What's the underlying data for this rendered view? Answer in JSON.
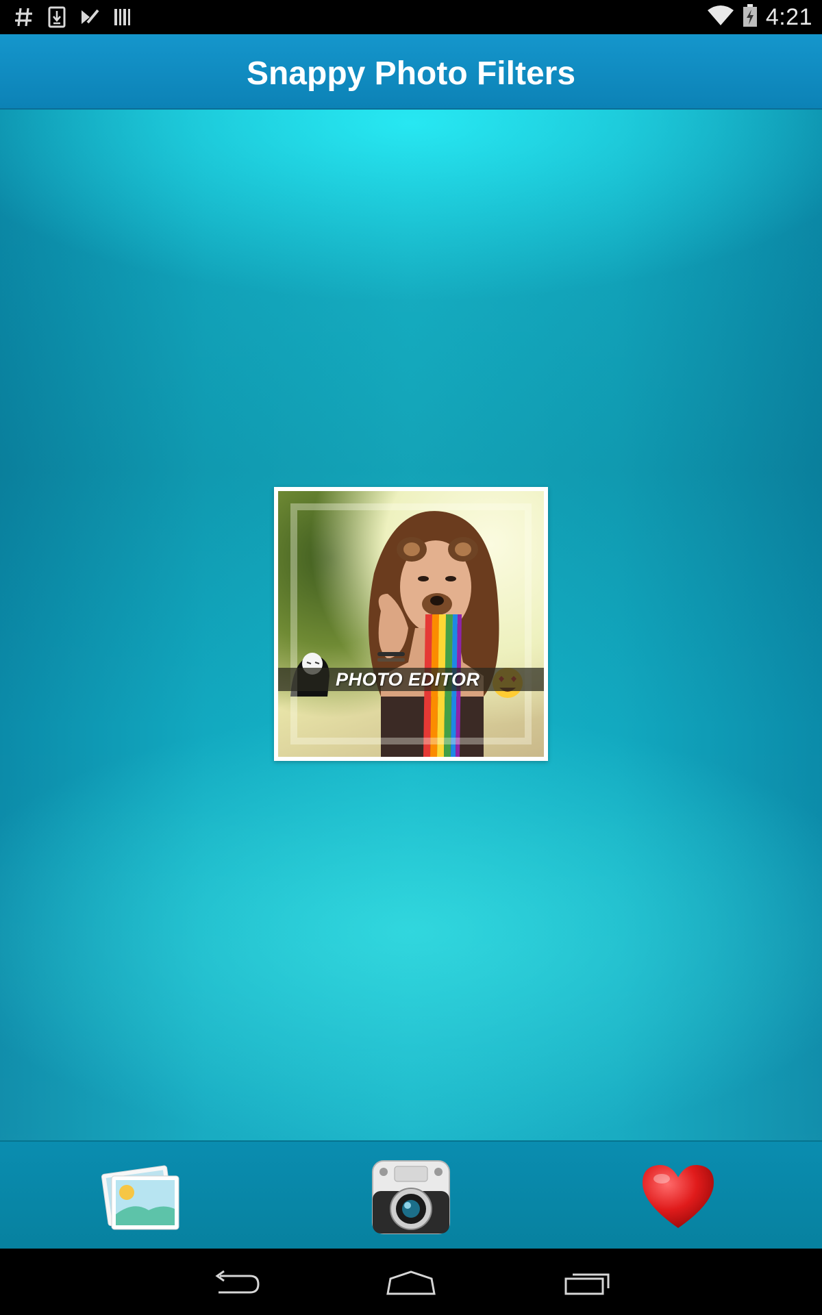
{
  "status_bar": {
    "icons": [
      "hash-icon",
      "download-icon",
      "play-store-icon",
      "barcode-icon"
    ],
    "wifi": "wifi-icon",
    "battery": "battery-charging-icon",
    "time": "4:21"
  },
  "action_bar": {
    "title": "Snappy Photo Filters"
  },
  "promo": {
    "banner_text": "PHOTO EDITOR"
  },
  "bottom_bar": {
    "items": [
      "gallery-icon",
      "camera-icon",
      "heart-icon"
    ]
  },
  "nav_bar": {
    "items": [
      "back-icon",
      "home-icon",
      "recents-icon"
    ]
  },
  "colors": {
    "action_bar": "#1596cc",
    "background_center": "#16b4c8",
    "background_edge": "#0b8ba9",
    "bottom_bar": "#0a8db0"
  }
}
